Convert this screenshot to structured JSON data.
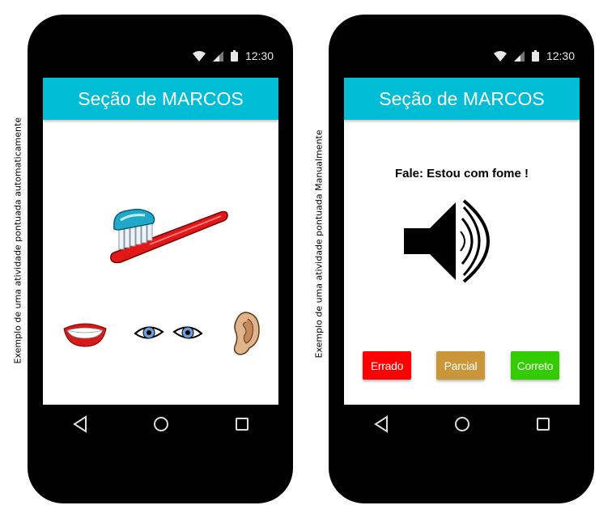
{
  "captions": {
    "left": "Exemplo de uma atividade pontuada automaticamente",
    "right": "Exemplo de uma atividade pontuada Manualmente"
  },
  "status_bar": {
    "time": "12:30",
    "icons": [
      "wifi-icon",
      "signal-icon",
      "battery-icon"
    ]
  },
  "navigation": {
    "icons": [
      "back-icon",
      "home-icon",
      "recents-icon"
    ]
  },
  "left_phone": {
    "app_title": "Seção de MARCOS",
    "main_image": "toothbrush-image",
    "options": [
      "mouth-image",
      "eyes-image",
      "ear-image"
    ]
  },
  "right_phone": {
    "app_title": "Seção de MARCOS",
    "prompt": "Fale: Estou com fome !",
    "speaker_icon": "speaker-icon",
    "buttons": [
      {
        "label": "Errado",
        "color": "#ff0000"
      },
      {
        "label": "Parcial",
        "color": "#c9973a"
      },
      {
        "label": "Correto",
        "color": "#33cc00"
      }
    ]
  },
  "colors": {
    "app_bar": "#00bcd4",
    "phone_body": "#000000"
  }
}
